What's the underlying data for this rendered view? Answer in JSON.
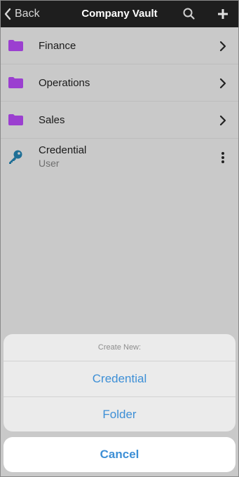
{
  "colors": {
    "navbar_bg": "#1e1e1e",
    "folder": "#9b3fd0",
    "key": "#1f6f96",
    "action_blue": "#3d8fd6",
    "overlay_bg": "#c9c9c9"
  },
  "navbar": {
    "back_label": "Back",
    "back_icon": "chevron-left-icon",
    "title": "Company Vault",
    "search_icon": "search-icon",
    "add_icon": "plus-icon"
  },
  "list": {
    "folders": [
      {
        "label": "Finance",
        "icon": "folder-icon"
      },
      {
        "label": "Operations",
        "icon": "folder-icon"
      },
      {
        "label": "Sales",
        "icon": "folder-icon"
      }
    ],
    "credential": {
      "title": "Credential",
      "subtitle": "User",
      "icon": "key-icon",
      "menu_icon": "more-vertical-icon"
    }
  },
  "action_sheet": {
    "header": "Create New:",
    "options": [
      "Credential",
      "Folder"
    ],
    "cancel_label": "Cancel"
  }
}
